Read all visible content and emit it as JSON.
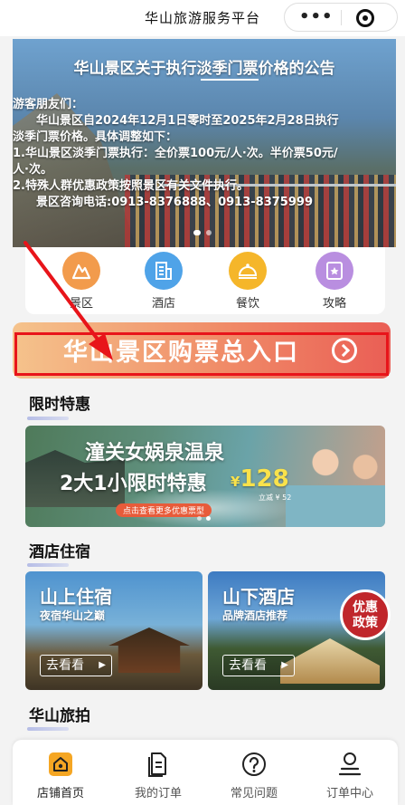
{
  "topbar": {
    "title": "华山旅游服务平台",
    "more_label": "•••"
  },
  "banner": {
    "title": "华山景区关于执行淡季门票价格的公告",
    "lines": [
      "游客朋友们：",
      "　　华山景区自2024年12月1日零时至2025年2月28日执行",
      "淡季门票价格。具体调整如下：",
      "1.华山景区淡季门票执行：全价票100元/人·次。半价票50元/",
      "人·次。",
      "2.特殊人群优惠政策按照景区有关文件执行。",
      "　　景区咨询电话:0913-8376888、0913-8375999"
    ]
  },
  "categories": [
    {
      "label": "景区",
      "icon": "mountain-icon",
      "color": "#f29b4c"
    },
    {
      "label": "酒店",
      "icon": "hotel-icon",
      "color": "#4fa3e8"
    },
    {
      "label": "餐饮",
      "icon": "dish-icon",
      "color": "#f5b62a"
    },
    {
      "label": "攻略",
      "icon": "guide-book-icon",
      "color": "#b98ee0"
    }
  ],
  "ticket_entry": {
    "label": "华山景区购票总入口"
  },
  "sections": {
    "limited": "限时特惠",
    "hotel": "酒店住宿",
    "photo": "华山旅拍"
  },
  "promo": {
    "line1": "潼关女娲泉温泉",
    "line2": "2大1小限时特惠",
    "currency": "¥",
    "price": "128",
    "save": "立减 ¥ 52",
    "tag": "点击查看更多优惠票型"
  },
  "hotels": [
    {
      "title": "山上住宿",
      "subtitle": "夜宿华山之巅",
      "button": "去看看"
    },
    {
      "title": "山下酒店",
      "subtitle": "品牌酒店推荐",
      "button": "去看看"
    }
  ],
  "badge": {
    "line1": "优惠",
    "line2": "政策"
  },
  "tabbar": [
    {
      "label": "店铺首页",
      "icon": "store-icon"
    },
    {
      "label": "我的订单",
      "icon": "order-icon"
    },
    {
      "label": "常见问题",
      "icon": "question-icon"
    },
    {
      "label": "订单中心",
      "icon": "user-icon"
    }
  ],
  "colors": {
    "accent": "#f5a623",
    "annotation_red": "#e8141a"
  }
}
